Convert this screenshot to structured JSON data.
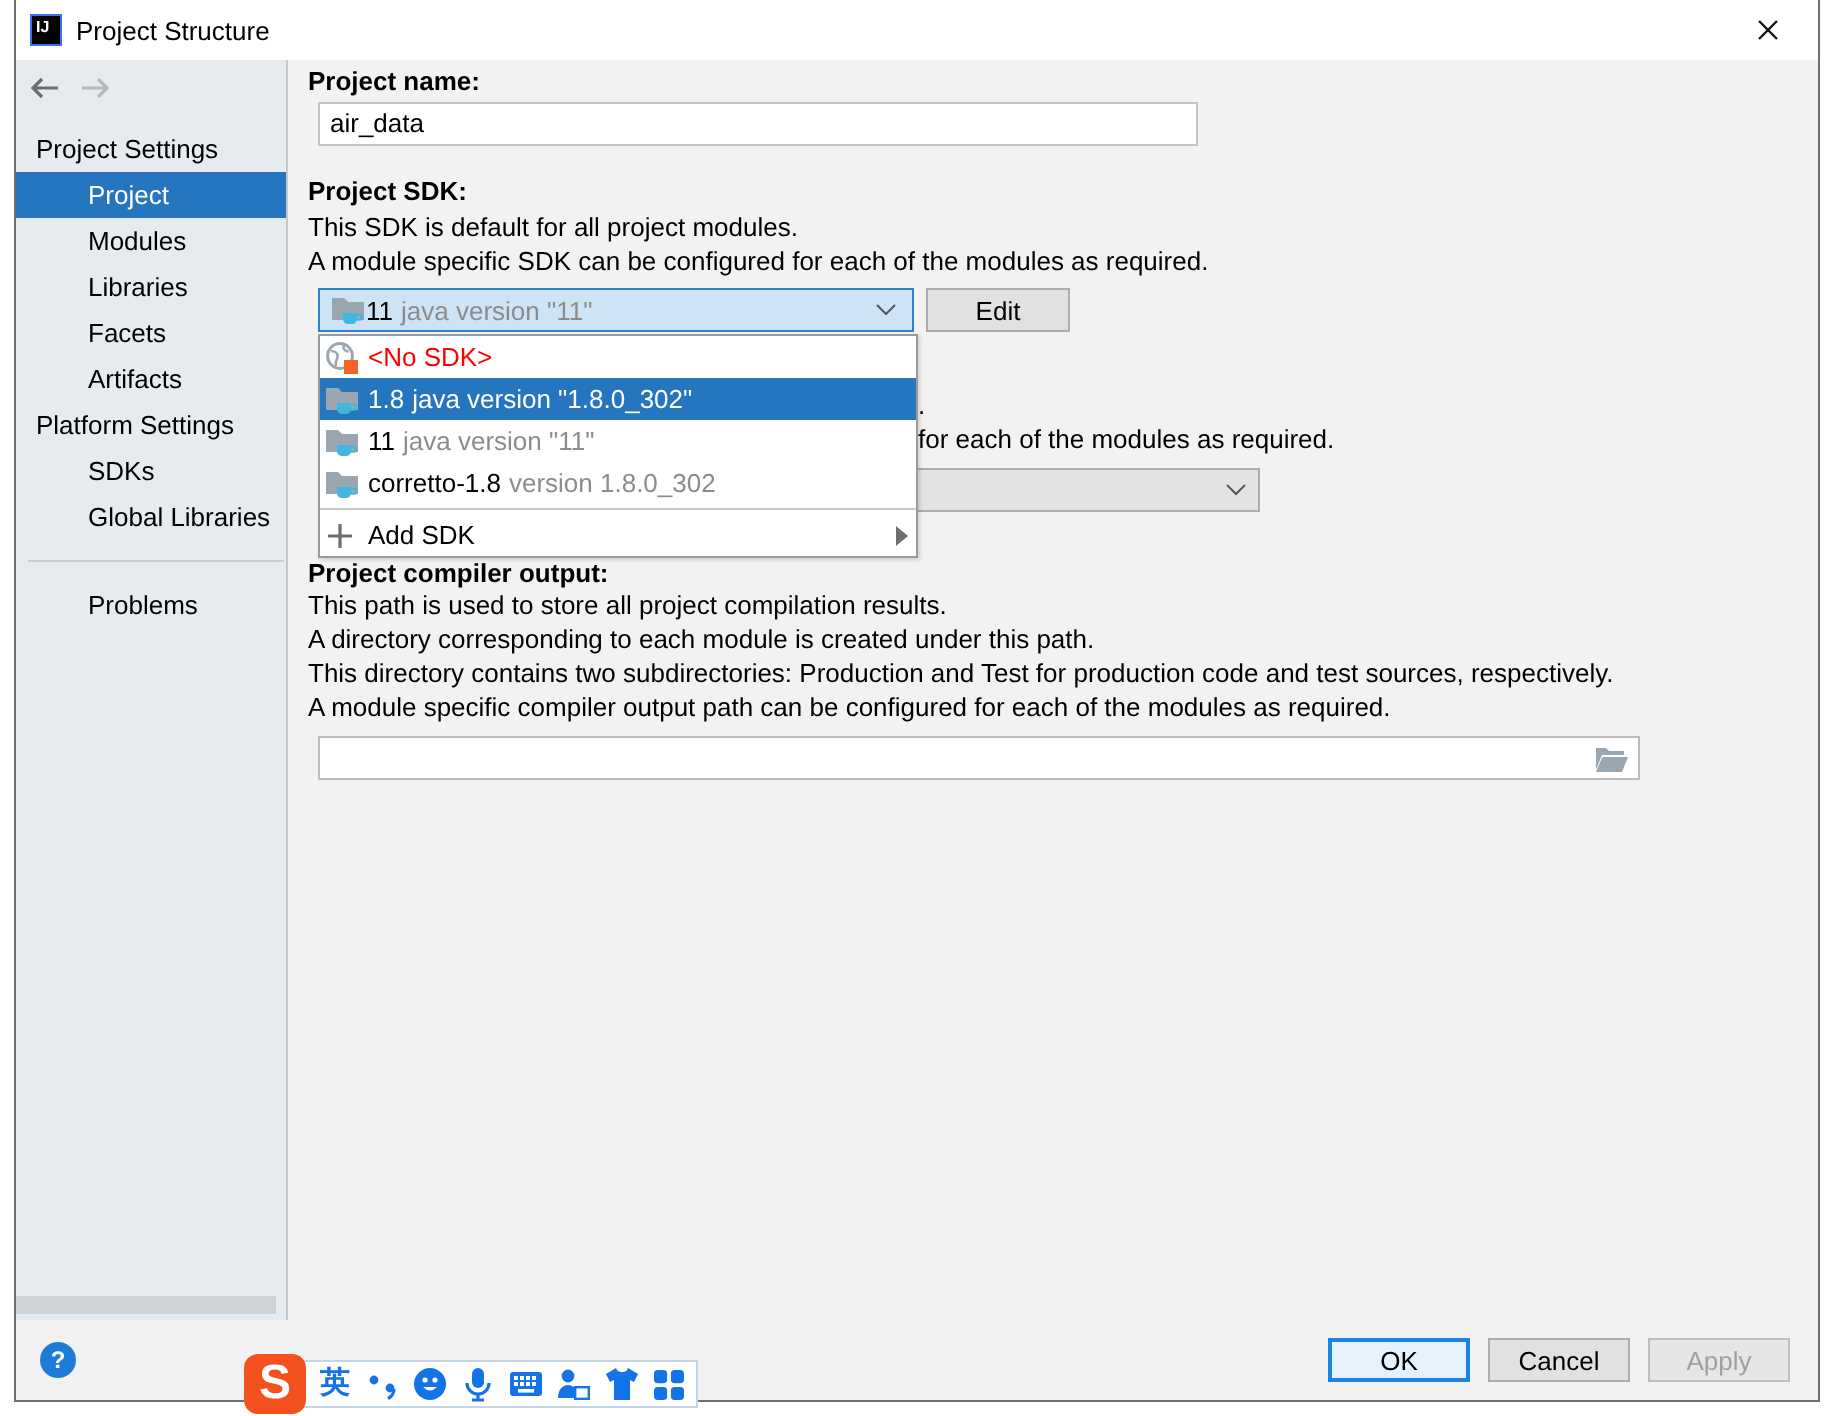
{
  "window": {
    "title": "Project Structure",
    "app_badge": "IJ"
  },
  "navigation": [
    {
      "kind": "back",
      "disabled": false
    },
    {
      "kind": "forward",
      "disabled": true
    }
  ],
  "sidebar": {
    "sections": [
      {
        "heading": "Project Settings",
        "items": [
          {
            "label": "Project",
            "selected": true
          },
          {
            "label": "Modules",
            "selected": false
          },
          {
            "label": "Libraries",
            "selected": false
          },
          {
            "label": "Facets",
            "selected": false
          },
          {
            "label": "Artifacts",
            "selected": false
          }
        ]
      },
      {
        "heading": "Platform Settings",
        "items": [
          {
            "label": "SDKs",
            "selected": false
          },
          {
            "label": "Global Libraries",
            "selected": false
          }
        ]
      }
    ],
    "after_divider": [
      {
        "label": "Problems",
        "selected": false
      }
    ]
  },
  "project_name": {
    "label": "Project name:",
    "value": "air_data"
  },
  "project_sdk": {
    "label": "Project SDK:",
    "description": [
      "This SDK is default for all project modules.",
      "A module specific SDK can be configured for each of the modules as required."
    ],
    "dropdown": {
      "expanded": true,
      "value": {
        "name": "11",
        "detail": "java version \"11\""
      },
      "options": [
        {
          "kind": "no_sdk",
          "name": "<No SDK>",
          "selected": false
        },
        {
          "kind": "sdk",
          "name": "1.8",
          "detail": "java version \"1.8.0_302\"",
          "selected": true
        },
        {
          "kind": "sdk",
          "name": "11",
          "detail": "java version \"11\"",
          "selected": false
        },
        {
          "kind": "sdk",
          "name": "corretto-1.8",
          "detail": "version 1.8.0_302",
          "selected": false
        },
        {
          "kind": "submenu",
          "name": "Add SDK",
          "selected": false
        }
      ]
    },
    "edit_button": "Edit"
  },
  "partly_covered_section": {
    "text_fragments": [
      ".",
      "for each of the modules as required."
    ]
  },
  "compiler_output": {
    "label": "Project compiler output:",
    "description": [
      "This path is used to store all project compilation results.",
      "A directory corresponding to each module is created under this path.",
      "This directory contains two subdirectories: Production and Test for production code and test sources, respectively.",
      "A module specific compiler output path can be configured for each of the modules as required."
    ]
  },
  "footer": {
    "help": "?",
    "buttons": [
      {
        "label": "OK",
        "default": true,
        "disabled": false
      },
      {
        "label": "Cancel",
        "default": false,
        "disabled": false
      },
      {
        "label": "Apply",
        "default": false,
        "disabled": true
      }
    ]
  },
  "ime_toolbar": {
    "logo": "S",
    "input_mode": "英"
  }
}
